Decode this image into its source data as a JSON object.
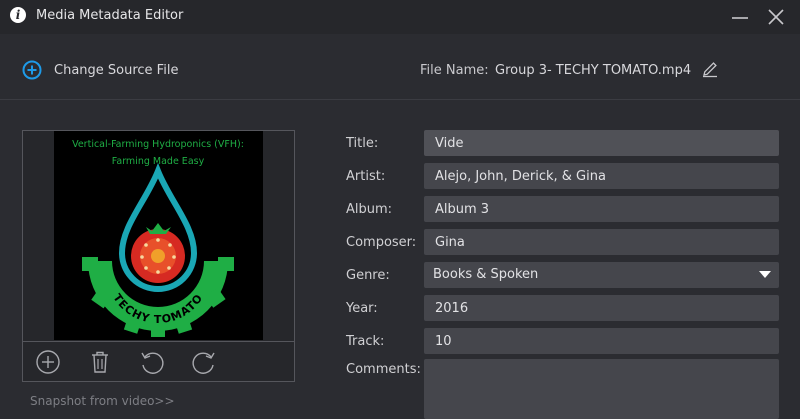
{
  "app": {
    "title": "Media Metadata Editor"
  },
  "toolbar": {
    "change_source_label": "Change Source File",
    "file_name_label": "File Name:",
    "file_name_value": "Group 3- TECHY TOMATO.mp4"
  },
  "cover": {
    "art_title_line1": "Vertical-Farming Hydroponics (VFH):",
    "art_title_line2": "Farming Made Easy",
    "art_brand": "TECHY TOMATO",
    "snapshot_link": "Snapshot from video>>"
  },
  "fields": {
    "title": {
      "label": "Title:",
      "value": "Vide"
    },
    "artist": {
      "label": "Artist:",
      "value": "Alejo, John, Derick, & Gina"
    },
    "album": {
      "label": "Album:",
      "value": "Album 3"
    },
    "composer": {
      "label": "Composer:",
      "value": "Gina"
    },
    "genre": {
      "label": "Genre:",
      "value": "Books & Spoken"
    },
    "year": {
      "label": "Year:",
      "value": "2016"
    },
    "track": {
      "label": "Track:",
      "value": "10"
    },
    "comments": {
      "label": "Comments:",
      "value": ""
    }
  },
  "colors": {
    "accent_blue": "#1e9be9",
    "art_green": "#1fae45",
    "art_teal": "#1aa7b5",
    "art_red": "#d62a22"
  }
}
